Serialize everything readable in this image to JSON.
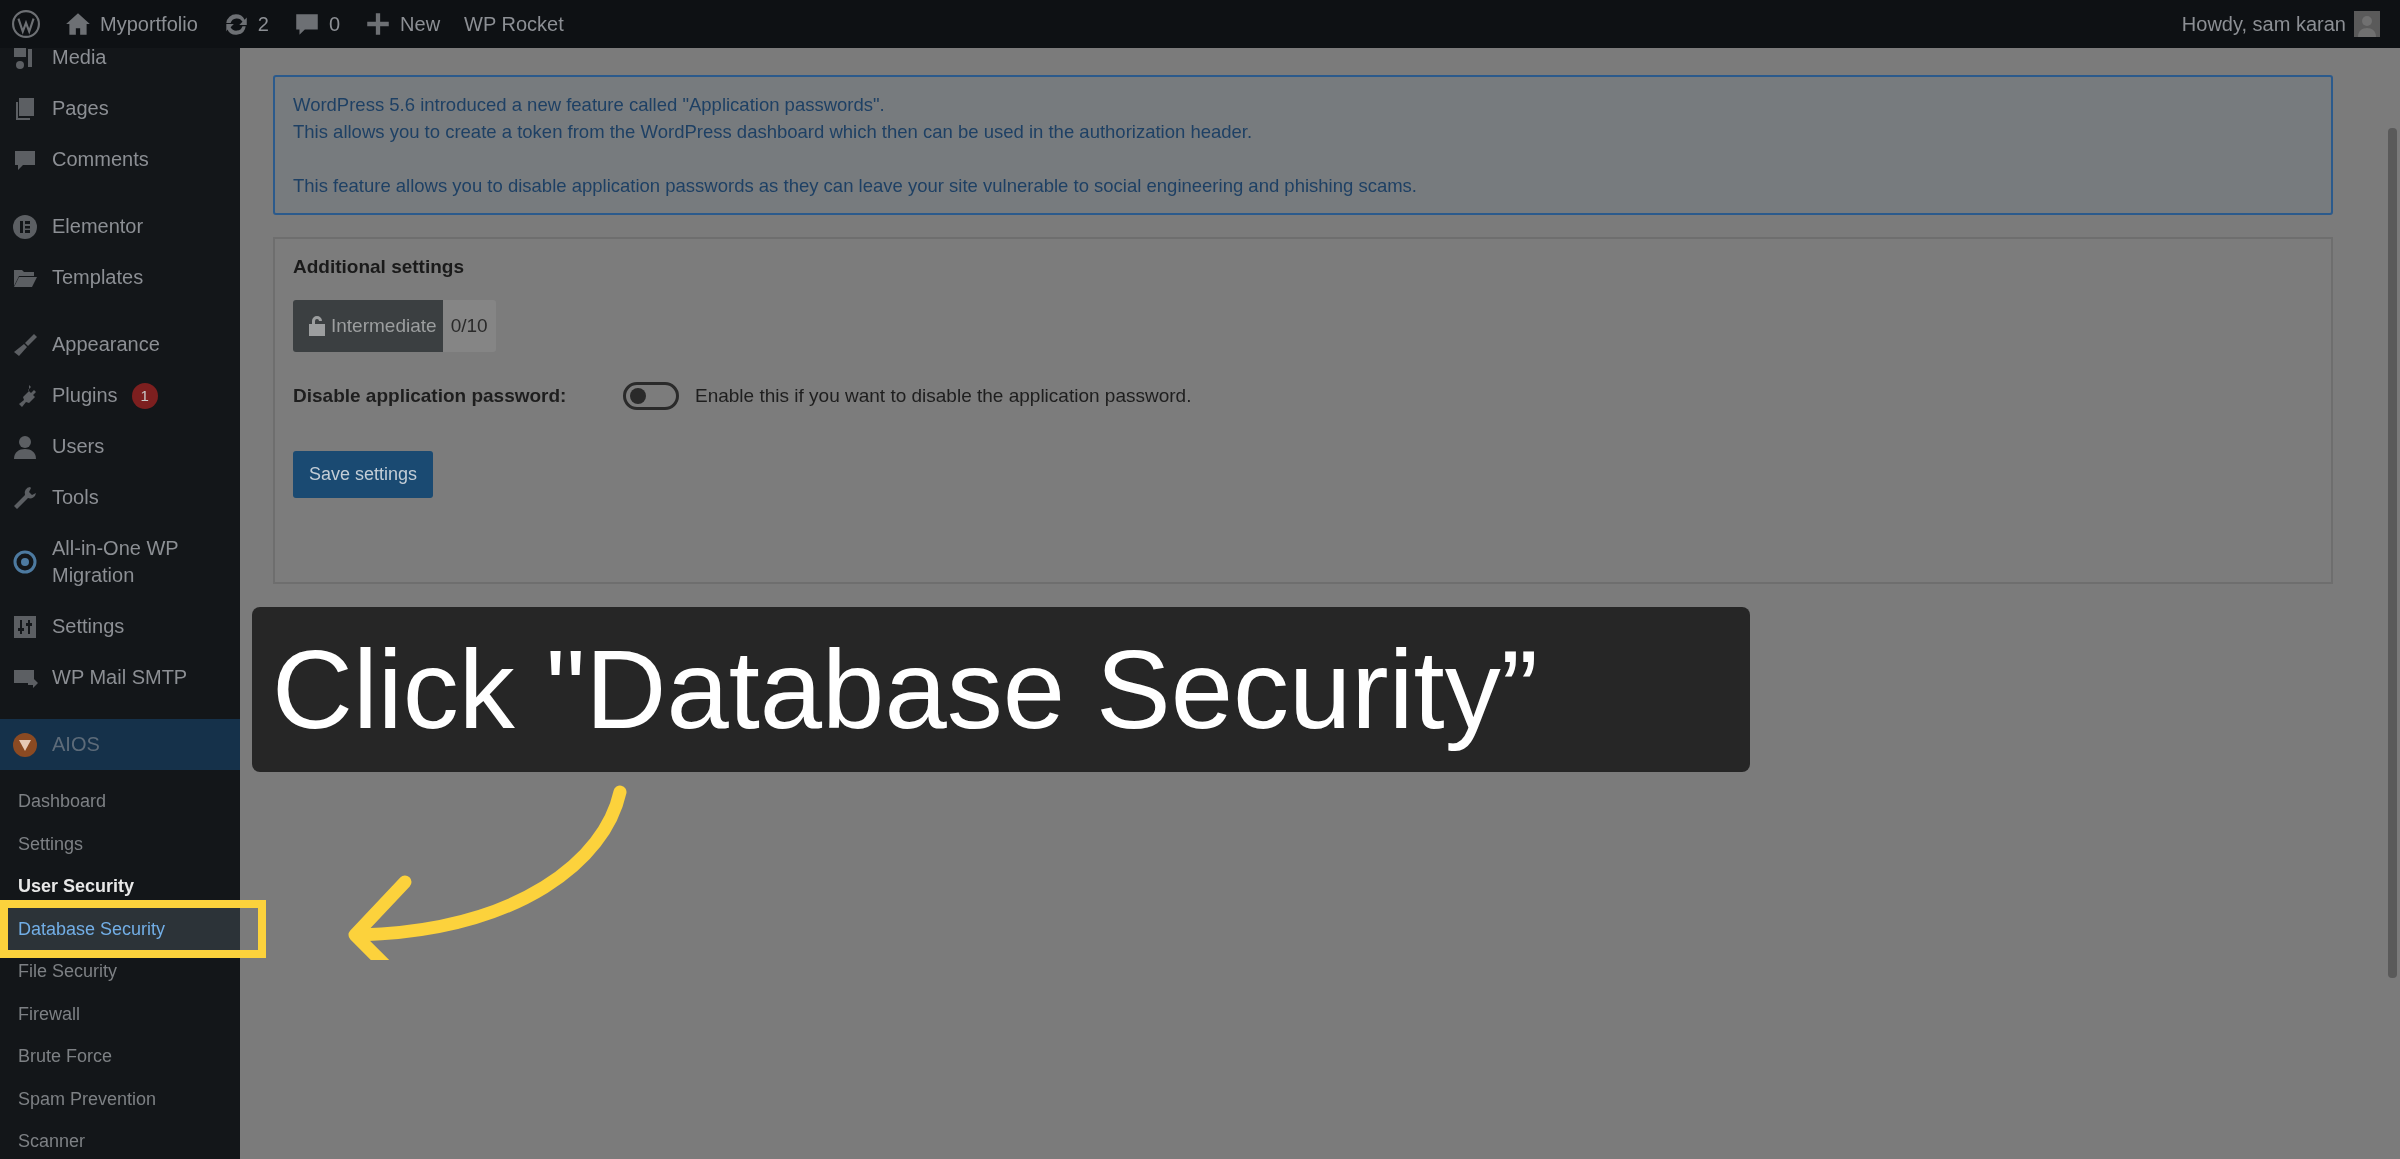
{
  "admin_bar": {
    "items": [
      {
        "kind": "logo"
      },
      {
        "kind": "home",
        "label": "Myportfolio"
      },
      {
        "kind": "updates",
        "label": "2"
      },
      {
        "kind": "comments",
        "label": "0"
      },
      {
        "kind": "new",
        "label": "New"
      },
      {
        "kind": "plain",
        "label": "WP Rocket"
      }
    ],
    "greeting": "Howdy, sam karan"
  },
  "sidebar": {
    "groups": [
      [
        {
          "label": "Media"
        },
        {
          "label": "Pages"
        },
        {
          "label": "Comments"
        }
      ],
      [
        {
          "label": "Elementor"
        },
        {
          "label": "Templates"
        }
      ],
      [
        {
          "label": "Appearance"
        },
        {
          "label": "Plugins",
          "badge": "1"
        },
        {
          "label": "Users"
        },
        {
          "label": "Tools"
        },
        {
          "label": "All-in-One WP Migration"
        },
        {
          "label": "Settings"
        },
        {
          "label": "WP Mail SMTP"
        }
      ]
    ],
    "open_menu": {
      "label": "AIOS",
      "submenu": [
        {
          "label": "Dashboard",
          "current": false,
          "highlighted": false
        },
        {
          "label": "Settings",
          "current": false,
          "highlighted": false
        },
        {
          "label": "User Security",
          "current": true,
          "highlighted": false
        },
        {
          "label": "Database Security",
          "current": false,
          "highlighted": true
        },
        {
          "label": "File Security",
          "current": false,
          "highlighted": false
        },
        {
          "label": "Firewall",
          "current": false,
          "highlighted": false
        },
        {
          "label": "Brute Force",
          "current": false,
          "highlighted": false
        },
        {
          "label": "Spam Prevention",
          "current": false,
          "highlighted": false
        },
        {
          "label": "Scanner",
          "current": false,
          "highlighted": false
        }
      ]
    }
  },
  "notice": {
    "paragraphs": [
      [
        "WordPress 5.6 introduced a new feature called \"Application passwords\".",
        "This allows you to create a token from the WordPress dashboard which then can be used in the authorization header."
      ],
      [
        "This feature allows you to disable application passwords as they can leave your site vulnerable to social engineering and phishing scams."
      ]
    ]
  },
  "settings_card": {
    "title": "Additional settings",
    "badge": {
      "label": "Intermediate",
      "score": "0/10"
    },
    "field": {
      "label": "Disable application password:",
      "on": false,
      "help": "Enable this if you want to disable the application password."
    },
    "save_button": "Save settings"
  },
  "caption": "Click \"Database Security”"
}
